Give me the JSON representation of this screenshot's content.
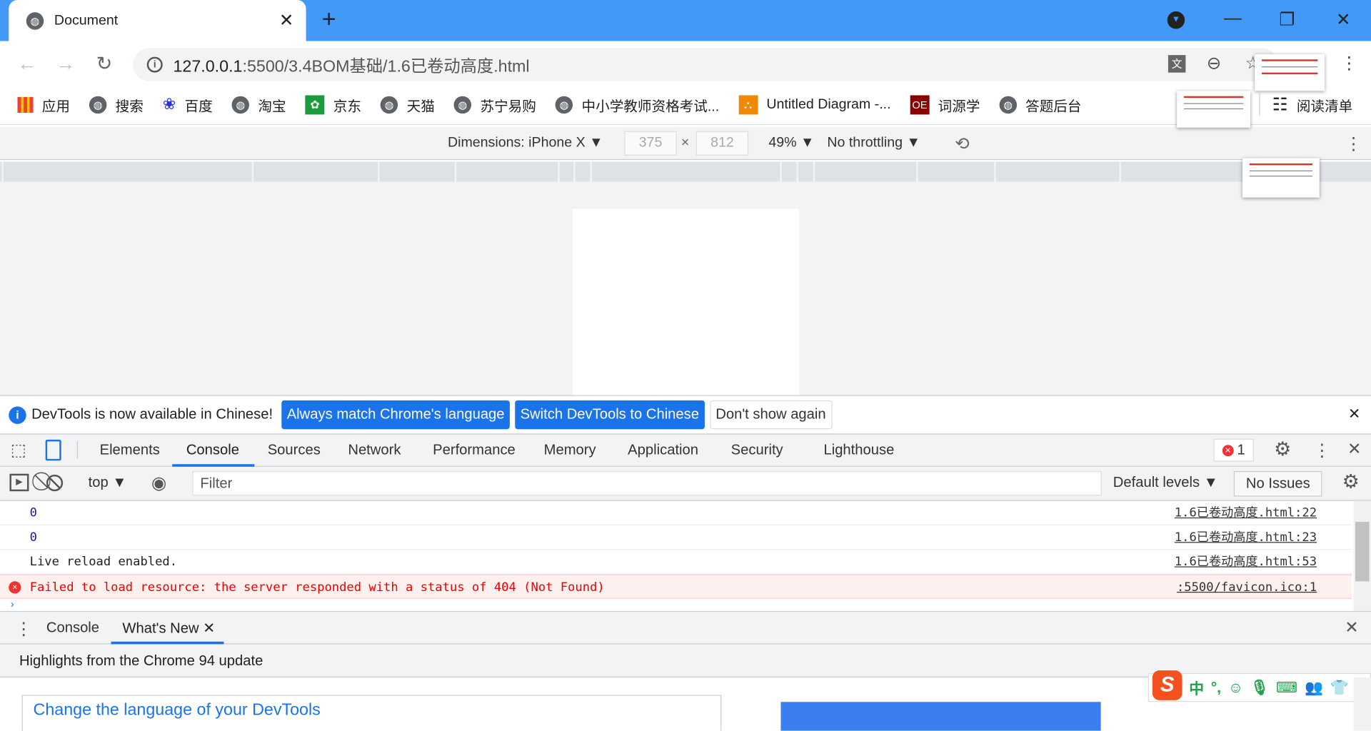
{
  "browser": {
    "tab_title": "Document",
    "url_host": "127.0.0.1",
    "url_path": ":5500/3.4BOM基础/1.6已卷动高度.html"
  },
  "bookmarks": [
    "应用",
    "搜索",
    "百度",
    "淘宝",
    "京东",
    "天猫",
    "苏宁易购",
    "中小学教师资格考试...",
    "Untitled Diagram -...",
    "词源学",
    "答题后台"
  ],
  "reading_list": "阅读清单",
  "device_toolbar": {
    "dimensions": "Dimensions: iPhone X",
    "width": "375",
    "x": "×",
    "height": "812",
    "zoom": "49%",
    "throttling": "No throttling"
  },
  "infobar": {
    "message": "DevTools is now available in Chinese!",
    "btn_match": "Always match Chrome's language",
    "btn_switch": "Switch DevTools to Chinese",
    "btn_dont": "Don't show again"
  },
  "devtools_tabs": [
    "Elements",
    "Console",
    "Sources",
    "Network",
    "Performance",
    "Memory",
    "Application",
    "Security",
    "Lighthouse"
  ],
  "error_count": "1",
  "console_toolbar": {
    "context": "top",
    "filter_placeholder": "Filter",
    "levels": "Default levels",
    "issues": "No Issues"
  },
  "console_rows": [
    {
      "text": "0",
      "source": "1.6已卷动高度.html:22"
    },
    {
      "text": "0",
      "source": "1.6已卷动高度.html:23"
    },
    {
      "text": "Live reload enabled.",
      "source": "1.6已卷动高度.html:53"
    },
    {
      "text": "Failed to load resource: the server responded with a status of 404 (Not Found)",
      "source": ":5500/favicon.ico:1"
    }
  ],
  "drawer": {
    "tabs": [
      "Console",
      "What's New"
    ],
    "highlights": "Highlights from the Chrome 94 update",
    "card_title": "Change the language of your DevTools"
  },
  "ime": {
    "mode": "中",
    "punct": "°,"
  }
}
